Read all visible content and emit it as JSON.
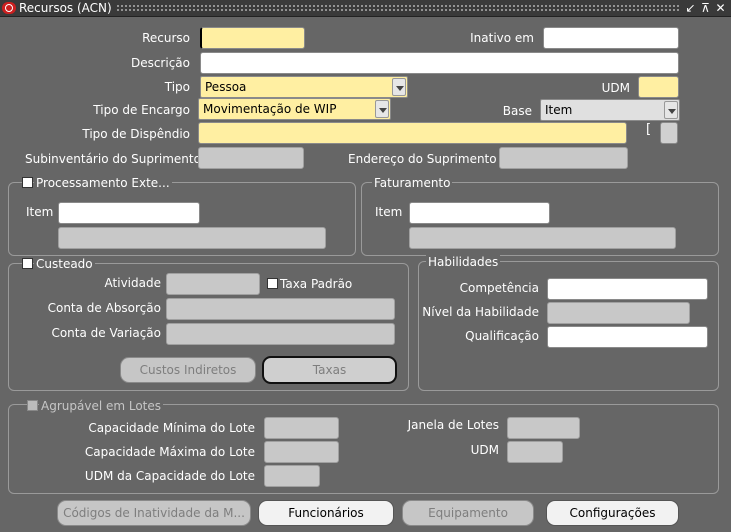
{
  "window": {
    "title": "Recursos (ACN)",
    "controls": [
      "↙",
      "⊼",
      "✕"
    ]
  },
  "header": {
    "recurso_label": "Recurso",
    "recurso_value": "",
    "inativo_label": "Inativo em",
    "inativo_value": "",
    "descricao_label": "Descrição",
    "descricao_value": "",
    "tipo_label": "Tipo",
    "tipo_value": "Pessoa",
    "udm_label": "UDM",
    "udm_value": "",
    "tipo_encargo_label": "Tipo de Encargo",
    "tipo_encargo_value": "Movimentação de WIP",
    "base_label": "Base",
    "base_value": "Item",
    "tipo_dispendio_label": "Tipo de Dispêndio",
    "tipo_dispendio_value": "",
    "bracket_symbol": "[",
    "subinventario_label": "Subinventário do Suprimento",
    "endereco_label": "Endereço do Suprimento"
  },
  "processamento": {
    "title": "Processamento Exte...",
    "item_label": "Item",
    "item_value": "",
    "item_desc_value": ""
  },
  "faturamento": {
    "title": "Faturamento",
    "item_label": "Item",
    "item_value": "",
    "item_desc_value": ""
  },
  "custeado": {
    "title": "Custeado",
    "atividade_label": "Atividade",
    "taxa_padrao_label": "Taxa Padrão",
    "conta_absorcao_label": "Conta de Absorção",
    "conta_variacao_label": "Conta de Variação",
    "custos_indiretos_button": "Custos Indiretos",
    "taxas_button": "Taxas"
  },
  "habilidades": {
    "title": "Habilidades",
    "competencia_label": "Competência",
    "nivel_label": "Nível da Habilidade",
    "qualificacao_label": "Qualificação"
  },
  "lotes": {
    "title": "Agrupável em Lotes",
    "cap_min_label": "Capacidade Mínima do Lote",
    "cap_max_label": "Capacidade Máxima do Lote",
    "udm_cap_label": "UDM da Capacidade do Lote",
    "janela_label": "Janela de Lotes",
    "udm_label": "UDM"
  },
  "footer": {
    "codigos_button": "Códigos de Inatividade da M...",
    "funcionarios_button": "Funcionários",
    "equipamento_button": "Equipamento",
    "configuracoes_button": "Configurações"
  },
  "colors": {
    "background": "#666666",
    "required_field": "#ffefa2",
    "disabled_field": "#c8c8c8",
    "brand_red": "#cc1f1f"
  }
}
